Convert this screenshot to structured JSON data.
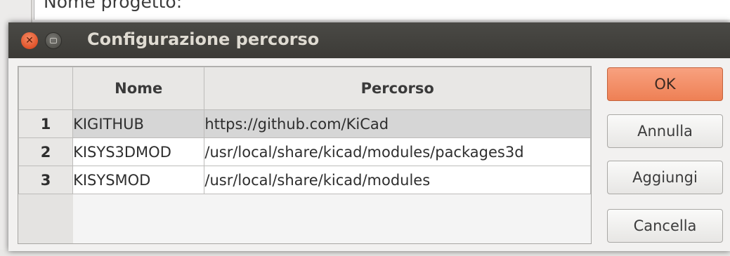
{
  "background": {
    "project_name_label": "Nome progetto:"
  },
  "dialog": {
    "title": "Configurazione percorso",
    "window_controls": {
      "close_icon": "close-icon",
      "minimize_icon": "minimize-icon"
    },
    "table": {
      "columns": [
        "Nome",
        "Percorso"
      ],
      "rows": [
        {
          "index": "1",
          "nome": "KIGITHUB",
          "percorso": "https://github.com/KiCad",
          "selected": true
        },
        {
          "index": "2",
          "nome": "KISYS3DMOD",
          "percorso": "/usr/local/share/kicad/modules/packages3d",
          "selected": false
        },
        {
          "index": "3",
          "nome": "KISYSMOD",
          "percorso": "/usr/local/share/kicad/modules",
          "selected": false
        }
      ]
    },
    "buttons": {
      "ok": "OK",
      "annulla": "Annulla",
      "aggiungi": "Aggiungi",
      "cancella": "Cancella"
    }
  },
  "colors": {
    "titlebar": "#3c3b37",
    "accent_ok": "#ee8055",
    "close_button": "#e0532a",
    "selected_row": "#d6d6d6"
  }
}
